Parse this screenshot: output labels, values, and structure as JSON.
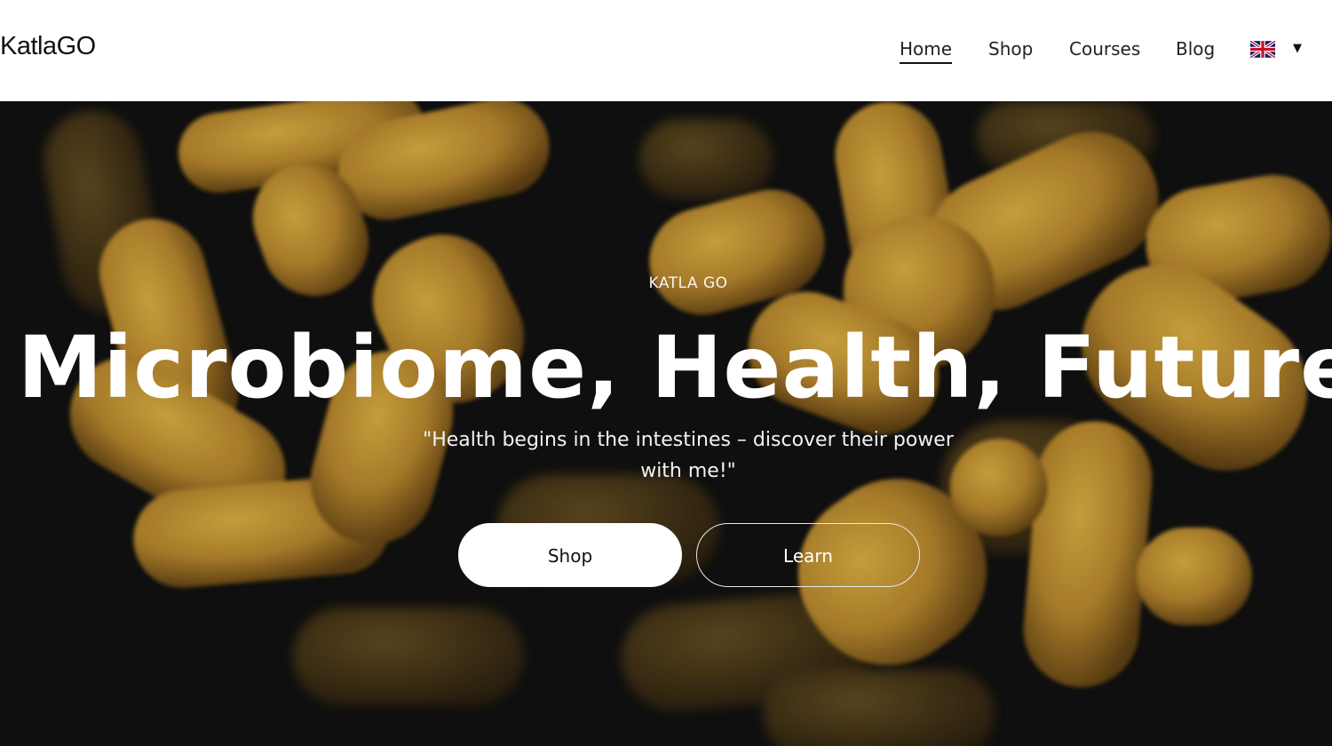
{
  "header": {
    "logo": "KatlaGO",
    "nav": [
      {
        "label": "Home",
        "active": true
      },
      {
        "label": "Shop",
        "active": false
      },
      {
        "label": "Courses",
        "active": false
      },
      {
        "label": "Blog",
        "active": false
      }
    ],
    "language": {
      "icon": "uk-flag-icon",
      "dropdown_icon": "caret-down-icon"
    }
  },
  "hero": {
    "eyebrow": "KATLA GO",
    "title": "Microbiome, Health, Future",
    "quote": "\"Health begins in the intestines – discover their power with me!\"",
    "buttons": {
      "primary": "Shop",
      "secondary": "Learn"
    },
    "background": "bacteria-image"
  },
  "colors": {
    "background": "#131313",
    "bacteria": "#c99432",
    "text_light": "#ffffff",
    "text_dark": "#111111"
  }
}
